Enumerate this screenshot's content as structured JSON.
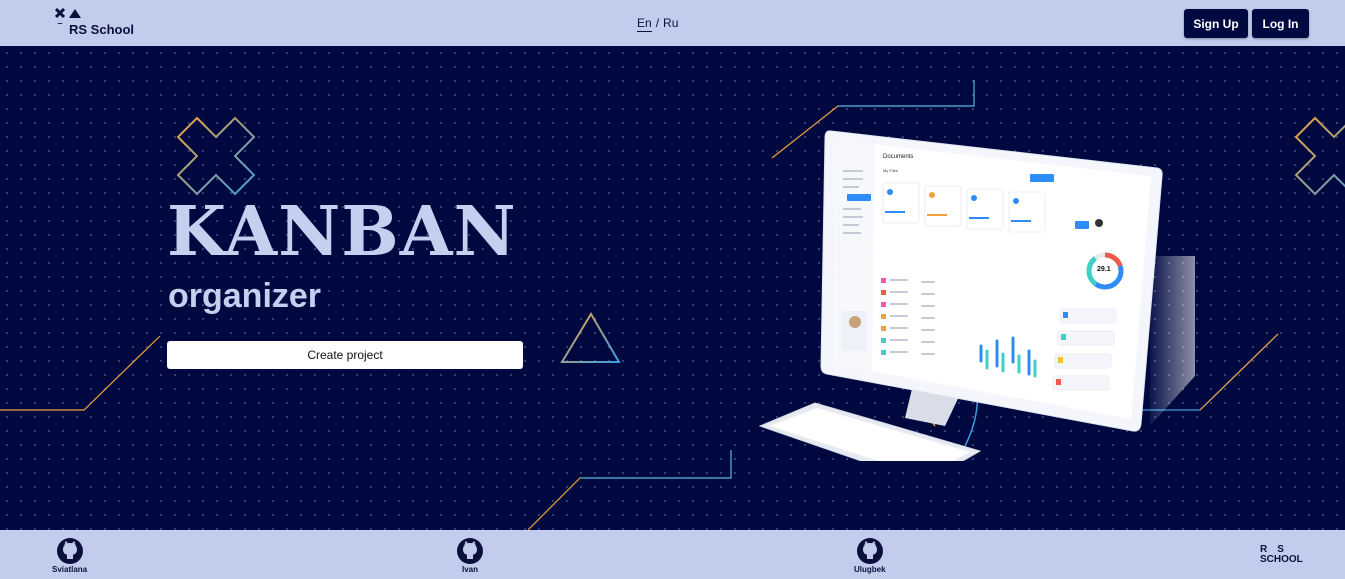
{
  "header": {
    "logo_text": "RS School",
    "lang_en": "En",
    "lang_separator": "/",
    "lang_ru": "Ru",
    "signup_label": "Sign Up",
    "login_label": "Log In"
  },
  "hero": {
    "title": "KANBAN",
    "subtitle": "organizer",
    "create_button": "Create project",
    "screen": {
      "app_name": "Drop",
      "page_title": "Documents",
      "section": "My Files",
      "user": "Angelina Jolie",
      "search_placeholder": "Search",
      "add_button": "Add Files",
      "storage_title": "Storage Details",
      "storage_value": "29.1",
      "storage_unit": "GB",
      "file_cards": [
        "Documents",
        "Google Drive",
        "One Drive",
        "Dropbox"
      ],
      "sidebar_items": [
        "Dashboard",
        "Transaction",
        "Task",
        "Documents",
        "Store",
        "Notification",
        "Profile",
        "Settings"
      ],
      "logout": "Logout",
      "recent_title": "Recent Files",
      "chart_title": "Statistic",
      "storage_list": [
        "Documents Files",
        "Media Files",
        "Other Files",
        "Unknown"
      ]
    }
  },
  "footer": {
    "devs": [
      "Sviatlana",
      "Ivan",
      "Ulugbek"
    ],
    "school_line1": "RS",
    "school_line2": "SCHOOL"
  },
  "colors": {
    "background": "#000840",
    "header_bg": "#c2cdee",
    "title_color": "#c5d0f0",
    "accent_orange": "#f0a13a",
    "accent_blue": "#3a9ee0"
  }
}
